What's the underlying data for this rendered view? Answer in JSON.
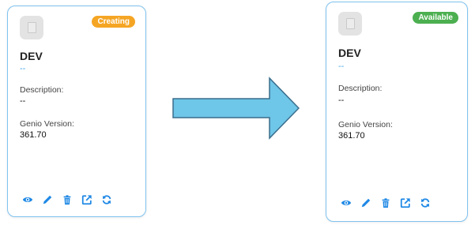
{
  "before": {
    "status": "Creating",
    "name": "DEV",
    "subtitle": "--",
    "description_label": "Description:",
    "description_value": "--",
    "version_label": "Genio Version:",
    "version_value": "361.70"
  },
  "after": {
    "status": "Available",
    "name": "DEV",
    "subtitle": "--",
    "description_label": "Description:",
    "description_value": "--",
    "version_label": "Genio Version:",
    "version_value": "361.70"
  },
  "actions": [
    "eye-icon",
    "pencil-icon",
    "trash-icon",
    "external-link-icon",
    "refresh-icon"
  ],
  "colors": {
    "accent": "#1e88e5",
    "creating": "#f5a524",
    "available": "#4caf50",
    "arrow_fill": "#6ec6e8",
    "arrow_stroke": "#3a6d8c",
    "card_border": "#7fc2ee"
  }
}
